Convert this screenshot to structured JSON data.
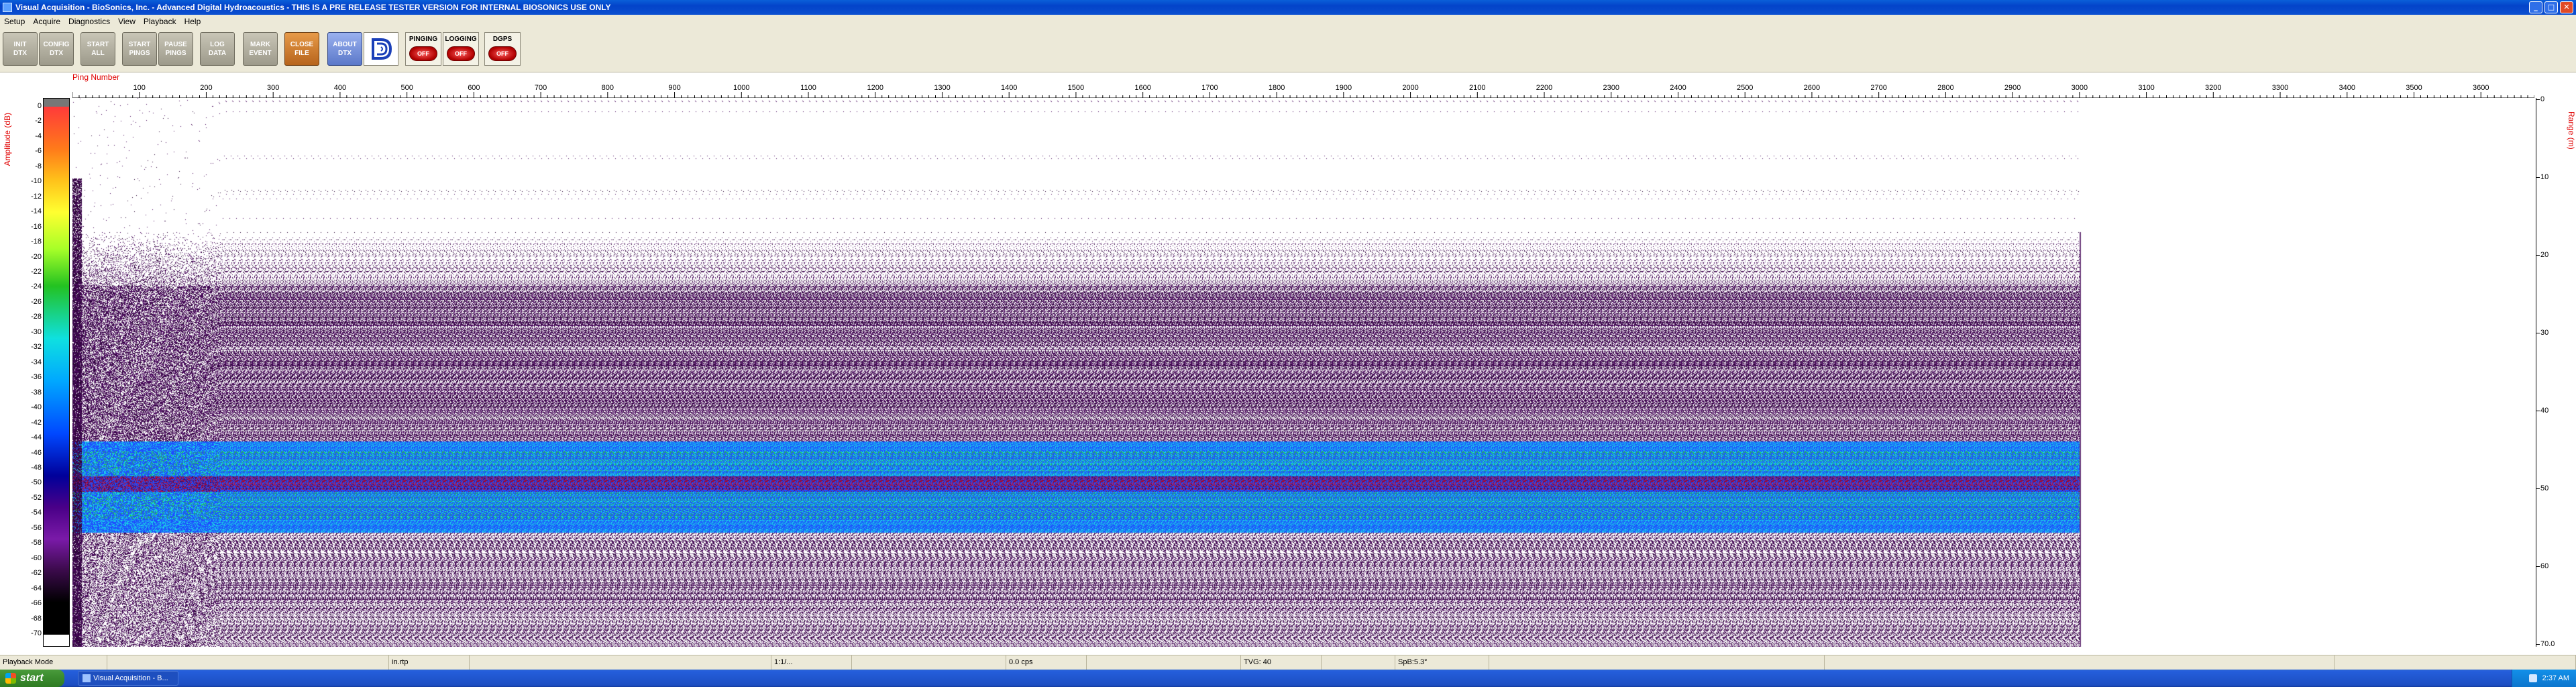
{
  "window": {
    "title": "Visual Acquisition  -  BioSonics, Inc.  -  Advanced Digital Hydroacoustics  -  THIS IS A PRE RELEASE TESTER VERSION FOR INTERNAL BIOSONICS USE ONLY",
    "minimize": "_",
    "maximize": "□",
    "close": "✕"
  },
  "menu": [
    "Setup",
    "Acquire",
    "Diagnostics",
    "View",
    "Playback",
    "Help"
  ],
  "toolbar": {
    "buttons": [
      {
        "label": "INIT\nDTX",
        "style": "gray"
      },
      {
        "label": "CONFIG\nDTX",
        "style": "gray"
      },
      {
        "label": "START\nALL",
        "style": "gray"
      },
      {
        "label": "START\nPINGS",
        "style": "gray"
      },
      {
        "label": "PAUSE\nPINGS",
        "style": "gray"
      },
      {
        "label": "LOG\nDATA",
        "style": "gray"
      },
      {
        "label": "MARK\nEVENT",
        "style": "gray"
      },
      {
        "label": "CLOSE\nFILE",
        "style": "orange"
      },
      {
        "label": "ABOUT\nDTX",
        "style": "blue"
      }
    ],
    "logo_icon": "biosonics-logo-icon",
    "indicators": [
      {
        "label": "PINGING",
        "state": "OFF"
      },
      {
        "label": "LOGGING",
        "state": "OFF"
      },
      {
        "label": "DGPS",
        "state": "OFF"
      }
    ]
  },
  "plot": {
    "x_axis_label": "Ping Number",
    "colorbar_label": "Amplitude (dB)",
    "range_label": "Range (m)",
    "x_ticks": [
      100,
      200,
      300,
      400,
      500,
      600,
      700,
      800,
      900,
      1000,
      1100,
      1200,
      1300,
      1400,
      1500,
      1600,
      1700,
      1800,
      1900,
      2000,
      2100,
      2200,
      2300,
      2400,
      2500,
      2600,
      2700,
      2800,
      2900,
      3000,
      3100,
      3200,
      3300,
      3400,
      3500,
      3600
    ],
    "x_range": [
      0,
      3680
    ],
    "data_ping_end": 3000,
    "colorbar_ticks": [
      "0",
      "-2",
      "-4",
      "-6",
      "-8",
      "-10",
      "-12",
      "-14",
      "-16",
      "-18",
      "-20",
      "-22",
      "-24",
      "-26",
      "-28",
      "-30",
      "-32",
      "-34",
      "-36",
      "-38",
      "-40",
      "-42",
      "-44",
      "-46",
      "-48",
      "-50",
      "-52",
      "-54",
      "-56",
      "-58",
      "-60",
      "-62",
      "-64",
      "-66",
      "-68",
      "-70"
    ],
    "range_ticks": [
      "0",
      "10",
      "20",
      "30",
      "40",
      "50",
      "60",
      "70.0"
    ],
    "range_max_m": 70,
    "colors": {
      "background": "#ffffff",
      "noise": "#4b0a5e",
      "noise_dark": "#2a0636",
      "band_blue": "#1e4dff",
      "band_cyan": "#19d6e6",
      "band_green": "#29c24a",
      "band_red": "#c8102e",
      "axis_label": "#e00000"
    }
  },
  "status": [
    "Playback Mode",
    "",
    "in.rtp",
    "",
    "1:1/...",
    "",
    "0.0 cps",
    "",
    "TVG: 40",
    "",
    "SpB:5.3°",
    "",
    "",
    ""
  ],
  "taskbar": {
    "start": "start",
    "task": "Visual Acquisition - B...",
    "clock": "2:37 AM"
  }
}
